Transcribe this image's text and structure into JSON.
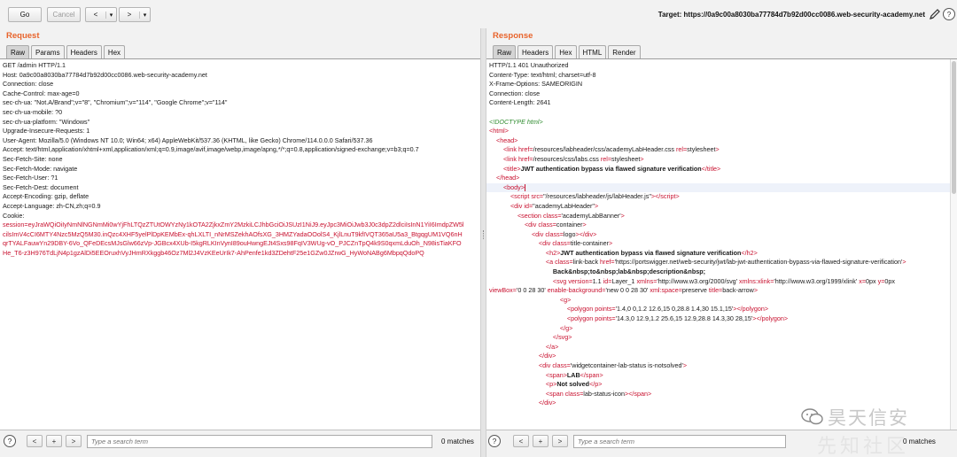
{
  "toolbar": {
    "go": "Go",
    "cancel": "Cancel",
    "back": "<",
    "forward": ">",
    "dropdown": "▾",
    "target": "Target: https://0a9c00a8030ba77784d7b92d00cc0086.web-security-academy.net",
    "help": "?"
  },
  "request": {
    "title": "Request",
    "tabs": [
      "Raw",
      "Params",
      "Headers",
      "Hex"
    ],
    "active_tab": "Raw",
    "lines": [
      "GET /admin HTTP/1.1",
      "Host: 0a9c00a8030ba77784d7b92d00cc0086.web-security-academy.net",
      "Connection: close",
      "Cache-Control: max-age=0",
      "sec-ch-ua: \"Not.A/Brand\";v=\"8\", \"Chromium\";v=\"114\", \"Google Chrome\";v=\"114\"",
      "sec-ch-ua-mobile: ?0",
      "sec-ch-ua-platform: \"Windows\"",
      "Upgrade-Insecure-Requests: 1",
      "User-Agent: Mozilla/5.0 (Windows NT 10.0; Win64; x64) AppleWebKit/537.36 (KHTML, like Gecko) Chrome/114.0.0.0 Safari/537.36",
      "Accept: text/html,application/xhtml+xml,application/xml;q=0.9,image/avif,image/webp,image/apng,*/*;q=0.8,application/signed-exchange;v=b3;q=0.7",
      "Sec-Fetch-Site: none",
      "Sec-Fetch-Mode: navigate",
      "Sec-Fetch-User: ?1",
      "Sec-Fetch-Dest: document",
      "Accept-Encoding: gzip, deflate",
      "Accept-Language: zh-CN,zh;q=0.9",
      "Cookie:"
    ],
    "cookie_value": "session=eyJraWQiOiIyNmNlNGNmMi0wYjFhLTQzZTUtOWYzNy1kOTA2ZjkxZmY2MzkiLCJhbGciOiJSUzI1NiJ9.eyJpc3MiOiJwb3J0c3dpZ2dlciIsInN1YiI6ImdpZW5lcilsImV4cCI6MTY4Nzc5MzQ5M30.inQzc4XHF5yelPlDpKEMbEx-qhLXLTI_nNrMSZekhAOfsXG_3HMZYadaOOolS4_KjlLnuT9kfIVQT365aU5a3_BtgqgUM1VQ6nHqrTYALFauwYn29DBY-6Vo_QFeDEcsMJsGlw66zVp-JGBcx4XUb-I5kgRLKInVynI89ouHwngEJt4Sxs98FqIV3WUg-vO_PJCZnTpQ4k9S0qxmLduOh_N98isTiaKFOHe_T6-z3H976TdLjN4p1gzAlDi5EEOruxhVyJHmRXkggb46Oz7Ml2J4VzKEeUrIk7-AhPenfe1kd3ZDehtF25e1GZw0JZrwG_HyWoNABg6MbpqQdoPQ",
    "search_placeholder": "Type a search term",
    "matches": "0 matches"
  },
  "response": {
    "title": "Response",
    "tabs": [
      "Raw",
      "Headers",
      "Hex",
      "HTML",
      "Render"
    ],
    "active_tab": "Raw",
    "header_lines": [
      "HTTP/1.1 401 Unauthorized",
      "Content-Type: text/html; charset=utf-8",
      "X-Frame-Options: SAMEORIGIN",
      "Connection: close",
      "Content-Length: 2641"
    ],
    "search_placeholder": "Type a search term",
    "matches": "0 matches"
  },
  "watermark": {
    "line1": "昊天信安",
    "line2": "先知社区"
  },
  "colors": {
    "accent": "#e8642c",
    "string_red": "#c8102e",
    "tag_green": "#2e8b2e"
  }
}
